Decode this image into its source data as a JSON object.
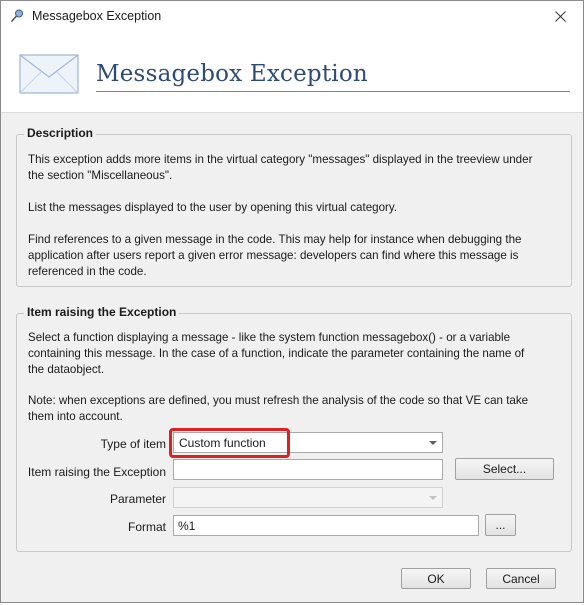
{
  "window": {
    "title": "Messagebox Exception"
  },
  "header": {
    "heading": "Messagebox Exception"
  },
  "description": {
    "legend": "Description",
    "lines_p1": [
      "This exception adds more items in the virtual category \"messages\" displayed in the treeview under",
      "the section \"Miscellaneous\"."
    ],
    "lines_p2": [
      "List the messages displayed to the user by opening this virtual category."
    ],
    "lines_p3": [
      "Find references to a given message in the code. This may help for instance when debugging the",
      "application after users report a given error message: developers can find where this message is",
      "referenced in the code."
    ]
  },
  "item_raising": {
    "legend": "Item raising the Exception",
    "lines_p1": [
      "Select a function displaying a message - like the system function messagebox() - or a variable",
      "containing this message. In the case of a function, indicate the parameter containing the name of",
      "the dataobject."
    ],
    "lines_p2": [
      "Note: when exceptions are defined, you must refresh the analysis of the code so that VE can take",
      "them into account."
    ],
    "type_label": "Type of item",
    "type_value": "Custom function",
    "item_label": "Item raising the Exception",
    "item_value": "",
    "select_button": "Select...",
    "parameter_label": "Parameter",
    "parameter_value": "",
    "format_label": "Format",
    "format_value": "%1",
    "browse_button": "..."
  },
  "footer": {
    "ok": "OK",
    "cancel": "Cancel"
  },
  "icons": {
    "app": "pin-icon",
    "close": "close-icon",
    "header": "envelope-icon"
  },
  "colors": {
    "heading": "#2e4a78",
    "highlight": "#e02020",
    "window_bg": "#f0f0f0"
  }
}
